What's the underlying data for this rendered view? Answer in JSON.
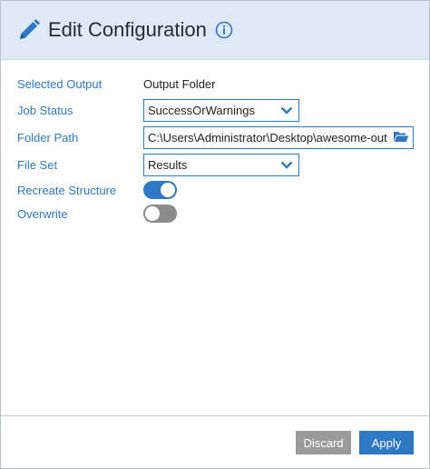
{
  "header": {
    "title": "Edit Configuration",
    "edit_icon": "pencil-icon",
    "info_icon": "info-icon"
  },
  "form": {
    "selected_output": {
      "label": "Selected Output",
      "value": "Output Folder"
    },
    "job_status": {
      "label": "Job Status",
      "value": "SuccessOrWarnings"
    },
    "folder_path": {
      "label": "Folder Path",
      "value": "C:\\Users\\Administrator\\Desktop\\awesome-out",
      "icon": "folder-open-icon"
    },
    "file_set": {
      "label": "File Set",
      "value": "Results"
    },
    "recreate_structure": {
      "label": "Recreate Structure",
      "on": true
    },
    "overwrite": {
      "label": "Overwrite",
      "on": false
    }
  },
  "footer": {
    "discard_label": "Discard",
    "apply_label": "Apply"
  },
  "colors": {
    "accent": "#2f78c4",
    "header_bg": "#dfe9f6",
    "discard_bg": "#9a9a9a",
    "toggle_off": "#8c8c8c"
  }
}
